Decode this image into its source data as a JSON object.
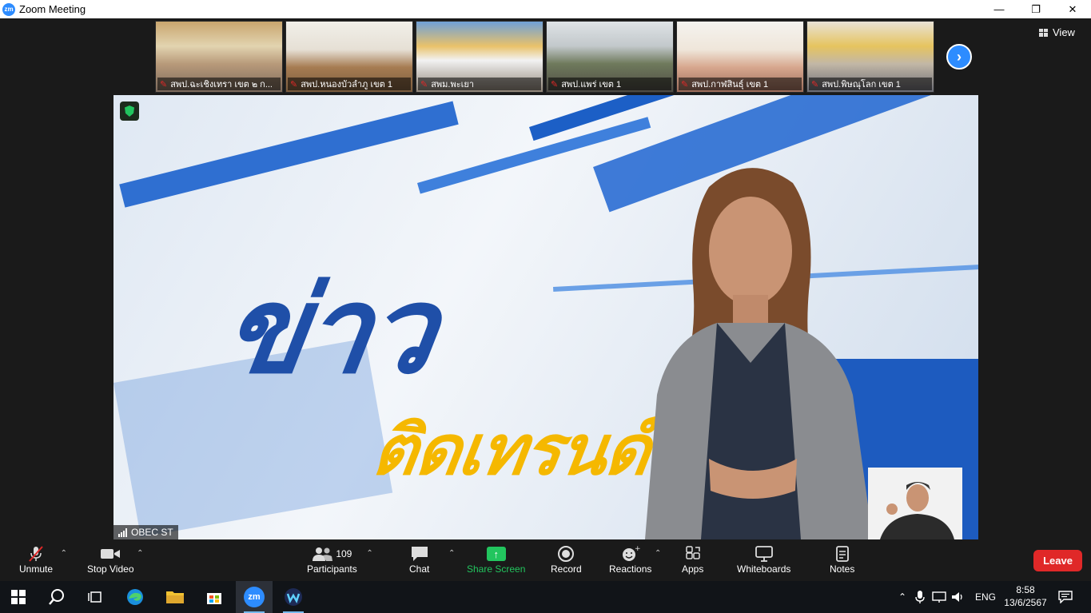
{
  "window": {
    "title": "Zoom Meeting",
    "logo_text": "zm",
    "minimize": "—",
    "restore": "❐",
    "close": "✕"
  },
  "gallery": {
    "thumbnails": [
      {
        "label": "สพป.ฉะเชิงเทรา เขต ๒ ก..."
      },
      {
        "label": "สพป.หนองบัวลำภู เขต 1"
      },
      {
        "label": "สพม.พะเยา"
      },
      {
        "label": "สพป.แพร่ เขต 1"
      },
      {
        "label": "สพป.กาฬสินธุ์ เขต 1"
      },
      {
        "label": "สพป.พิษณุโลก เขต 1"
      }
    ],
    "next_icon": "›",
    "view_label": "View"
  },
  "stage": {
    "headline_top": "ข่าว",
    "headline_bottom": "ติดเทรนด์",
    "speaker_name": "OBEC ST"
  },
  "toolbar": {
    "unmute": "Unmute",
    "stop_video": "Stop Video",
    "participants": "Participants",
    "participants_count": "109",
    "chat": "Chat",
    "share_screen": "Share Screen",
    "record": "Record",
    "reactions": "Reactions",
    "apps": "Apps",
    "whiteboards": "Whiteboards",
    "notes": "Notes",
    "leave": "Leave"
  },
  "taskbar": {
    "language": "ENG",
    "time": "8:58",
    "date": "13/6/2567",
    "zoom_icon_text": "zm"
  },
  "colors": {
    "accent": "#2d8cff",
    "leave": "#e02828",
    "share": "#22c55e",
    "headline_blue": "#1f4fa8",
    "headline_yellow": "#f5b800"
  }
}
